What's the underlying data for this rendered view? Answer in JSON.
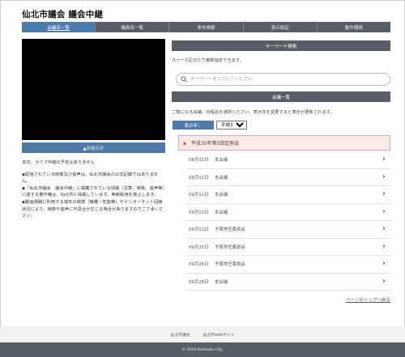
{
  "header": {
    "site_title": "仙北市議会 議会中継"
  },
  "nav": {
    "items": [
      {
        "label": "会議名一覧",
        "active": true
      },
      {
        "label": "議員名一覧",
        "active": false
      },
      {
        "label": "条件検索",
        "active": false
      },
      {
        "label": "表示設定",
        "active": false
      },
      {
        "label": "動作環境",
        "active": false
      }
    ]
  },
  "left": {
    "notice_label": "▲お知らせ",
    "live_status": "本日、ライブ中継の予定はありません",
    "notes": [
      "◆配信されている映像及び音声は、仙北市議会の公式記録ではありません。",
      "◆「仙北市議会　議会中継」に掲載されている情報（文章、映像、音声等）に関する著作権は、仙北市に帰属しています。無断転用を禁止します。",
      "◆動画視聴に利用する端末の環境（機種・性能等）やインターネット回線状況により、映像や音声に不具合が生じる場合がありますのでご了承ください。"
    ]
  },
  "keyword": {
    "heading": "キーワード検索",
    "help": "スペース区切りで複数指定できます。",
    "placeholder": "キーワードを入力してください"
  },
  "meetings": {
    "heading": "会議一覧",
    "help": "ご覧になる会議／日程名を選択ください。表示年を変更すると表示が更新されます。",
    "year_label": "表示年：",
    "year_selected": "平成30年",
    "session_title": "平成30年第5回定例会",
    "rows": [
      {
        "date": "08月31日",
        "name": "本会議"
      },
      {
        "date": "09月11日",
        "name": "本会議"
      },
      {
        "date": "09月12日",
        "name": "本会議"
      },
      {
        "date": "09月13日",
        "name": "本会議"
      },
      {
        "date": "09月13日",
        "name": "予算常任委員会"
      },
      {
        "date": "09月25日",
        "name": "予算常任委員会"
      },
      {
        "date": "09月26日",
        "name": "予算常任委員会"
      },
      {
        "date": "09月28日",
        "name": "本会議"
      }
    ]
  },
  "to_top": "ページのトップへ戻る",
  "footer": {
    "links": [
      "仙北市議会",
      "仙北市webサイト"
    ],
    "copyright": "© 2018 Semboku City."
  },
  "colors": {
    "nav_bg": "#595e66",
    "accent_blue": "#4f7aa8",
    "session_bg": "#fbe9e9"
  }
}
